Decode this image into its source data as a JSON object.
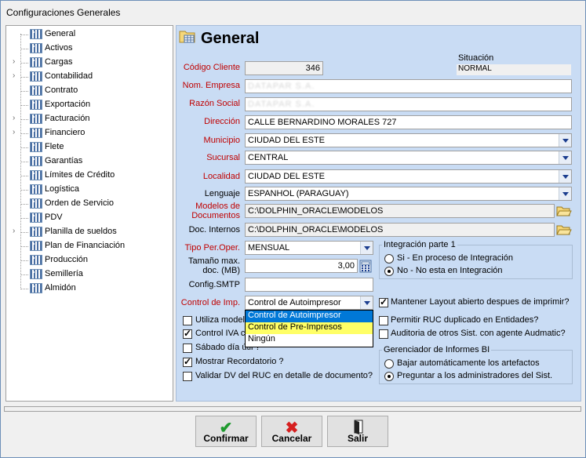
{
  "window": {
    "title": "Configuraciones Generales"
  },
  "tree": {
    "items": [
      {
        "label": "General",
        "exp": false
      },
      {
        "label": "Activos",
        "exp": false
      },
      {
        "label": "Cargas",
        "exp": true
      },
      {
        "label": "Contabilidad",
        "exp": true
      },
      {
        "label": "Contrato",
        "exp": false
      },
      {
        "label": "Exportación",
        "exp": false
      },
      {
        "label": "Facturación",
        "exp": true
      },
      {
        "label": "Financiero",
        "exp": true
      },
      {
        "label": "Flete",
        "exp": false
      },
      {
        "label": "Garantías",
        "exp": false
      },
      {
        "label": "Límites de Crédito",
        "exp": false
      },
      {
        "label": "Logística",
        "exp": false
      },
      {
        "label": "Orden de Servicio",
        "exp": false
      },
      {
        "label": "PDV",
        "exp": false
      },
      {
        "label": "Planilla de sueldos",
        "exp": true
      },
      {
        "label": "Plan de Financiación",
        "exp": false
      },
      {
        "label": "Producción",
        "exp": false
      },
      {
        "label": "Semillería",
        "exp": false
      },
      {
        "label": "Almidón",
        "exp": false
      }
    ]
  },
  "panel": {
    "title": "General",
    "codigo_cliente_label": "Código Cliente",
    "codigo_cliente": "346",
    "situacion_label": "Situación",
    "situacion": "NORMAL",
    "nom_empresa_label": "Nom. Empresa",
    "nom_empresa": "DATAPAR S.A.",
    "razon_social_label": "Razón Social",
    "razon_social": "DATAPAR S.A.",
    "direccion_label": "Dirección",
    "direccion": "CALLE BERNARDINO MORALES 727",
    "municipio_label": "Municipio",
    "municipio": "CIUDAD DEL ESTE",
    "sucursal_label": "Sucursal",
    "sucursal": "CENTRAL",
    "localidad_label": "Localidad",
    "localidad": "CIUDAD DEL ESTE",
    "lenguaje_label": "Lenguaje",
    "lenguaje": "ESPANHOL (PARAGUAY)",
    "modelos_label_1": "Modelos de",
    "modelos_label_2": "Documentos",
    "modelos": "C:\\DOLPHIN_ORACLE\\MODELOS",
    "doc_internos_label": "Doc. Internos",
    "doc_internos": "C:\\DOLPHIN_ORACLE\\MODELOS",
    "tipo_per_label": "Tipo Per.Oper.",
    "tipo_per": "MENSUAL",
    "tamano_label_1": "Tamaño max.",
    "tamano_label_2": "doc. (MB)",
    "tamano": "3,00",
    "config_smtp_label": "Config.SMTP",
    "config_smtp": "",
    "control_imp_label": "Control de Imp.",
    "control_imp": "Control de Autoimpresor",
    "control_imp_options": [
      "Control de Autoimpresor",
      "Control de Pre-Impresos",
      "Ningún"
    ],
    "chk_utiliza": "Utiliza modelo",
    "chk_control_iva": "Control IVA c",
    "chk_sabado": "Sábado día útil ?",
    "chk_recordatorio": "Mostrar Recordatorio ?",
    "chk_validar_dv": "Validar DV del RUC en detalle de documento?",
    "integracion_title": "Integración parte 1",
    "integracion_si": "Si - En proceso de Integración",
    "integracion_no": "No - No esta en Integración",
    "chk_mantener": "Mantener Layout abierto despues de imprimir?",
    "chk_permitir_ruc": "Permitir RUC duplicado en Entidades?",
    "chk_auditoria": "Auditoria de otros Sist. con agente Audmatic?",
    "gerenciador_title": "Gerenciador de Informes BI",
    "gerenciador_bajar": "Bajar automáticamente los artefactos",
    "gerenciador_preguntar": "Preguntar a los administradores del Sist."
  },
  "buttons": {
    "confirmar": "Confirmar",
    "cancelar": "Cancelar",
    "salir": "Salir"
  },
  "colors": {
    "accent": "#c00000",
    "panel_bg": "#c9dcf4",
    "highlight": "#0078d7",
    "selected_yellow": "#ffff66"
  }
}
